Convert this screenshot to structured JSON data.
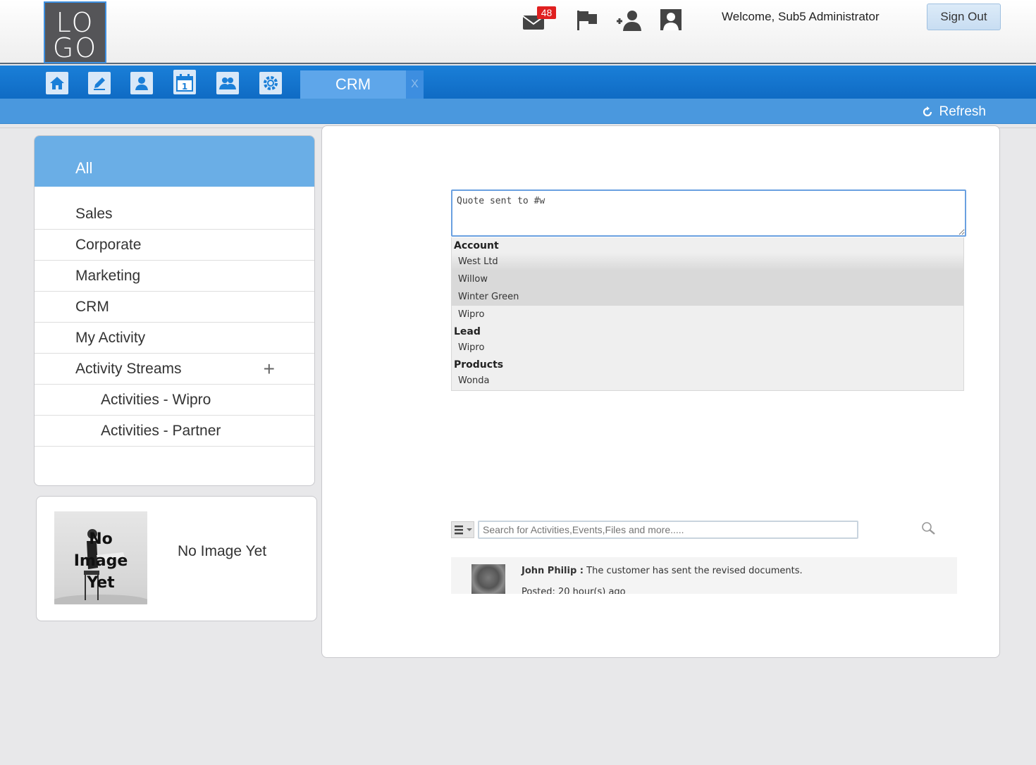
{
  "header": {
    "logo_line1": "LO",
    "logo_line2": "GO",
    "mail_count": "48",
    "welcome": "Welcome, Sub5 Administrator",
    "sign_out": "Sign Out",
    "icons": [
      "mail-icon",
      "flag-icon",
      "add-user-icon",
      "user-profile-icon"
    ]
  },
  "nav": {
    "icons": [
      "home-icon",
      "edit-icon",
      "user-icon",
      "calendar-icon",
      "group-icon",
      "settings-icon"
    ],
    "active_tab": "CRM",
    "close_tab": "X",
    "refresh": "Refresh"
  },
  "sidebar": {
    "all": "All",
    "items": [
      {
        "label": "Sales"
      },
      {
        "label": "Corporate"
      },
      {
        "label": "Marketing"
      },
      {
        "label": "CRM"
      },
      {
        "label": "My Activity"
      },
      {
        "label": "Activity Streams"
      },
      {
        "label": "Activities - Wipro"
      },
      {
        "label": "Activities - Partner"
      }
    ]
  },
  "image_card": {
    "placeholder_line1": "No",
    "placeholder_line2": "Image",
    "placeholder_line3": "Yet",
    "caption": "No Image Yet"
  },
  "composer": {
    "value": "Quote sent to #w"
  },
  "suggestions": {
    "group1": "Account",
    "account": [
      "West Ltd",
      "Willow",
      "Winter Green",
      "Wipro"
    ],
    "group2": "Lead",
    "lead": [
      "Wipro"
    ],
    "group3": "Products",
    "products": [
      "Wonda"
    ]
  },
  "search": {
    "placeholder": "Search for Activities,Events,Files and more....."
  },
  "activity": {
    "author": "John Philip :",
    "message": " The customer has sent the revised documents.",
    "posted": "Posted: 20 hour(s) ago"
  },
  "colors": {
    "nav_blue": "#1a7fd8",
    "sidebar_active": "#6aaee6",
    "badge_red": "#e02020"
  }
}
